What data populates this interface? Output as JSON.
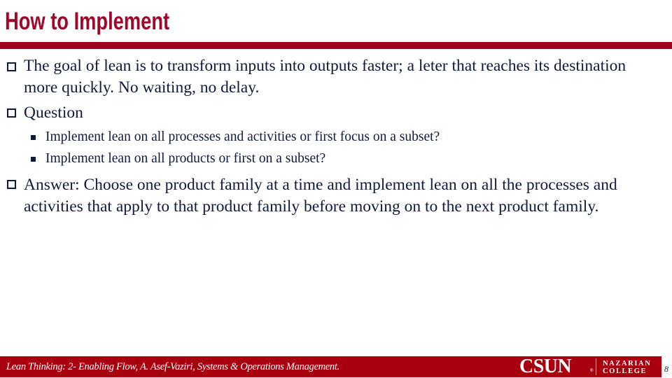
{
  "slide": {
    "title": "How to Implement",
    "bullets": [
      {
        "text": "The goal of lean is to transform inputs into outputs faster;  a leter that reaches its destination more quickly. No waiting, no delay."
      },
      {
        "text": "Question",
        "sub_bullets": [
          "Implement lean on all  processes and activities or  first focus on a subset?",
          "Implement lean on all products or first on a subset?"
        ]
      },
      {
        "text": "Answer: Choose one product family at a time and implement lean on all the processes and activities that apply to that product family before moving on to the next product family."
      }
    ]
  },
  "footer": {
    "text": "Lean Thinking:  2- Enabling Flow, A. Asef-Vaziri, Systems & Operations Management.",
    "logo_primary": "CSUN",
    "logo_registered": "®",
    "logo_college_line1": "NAZARIAN",
    "logo_college_line2": "COLLEGE",
    "page_number": "8"
  },
  "colors": {
    "title": "#a0082a",
    "rule": "#a10323",
    "body_text": "#0e1b3d",
    "footer_bar": "#a8000f"
  },
  "icons": {
    "bullet_level1": "hollow-square-icon",
    "bullet_level2": "filled-square-icon"
  }
}
